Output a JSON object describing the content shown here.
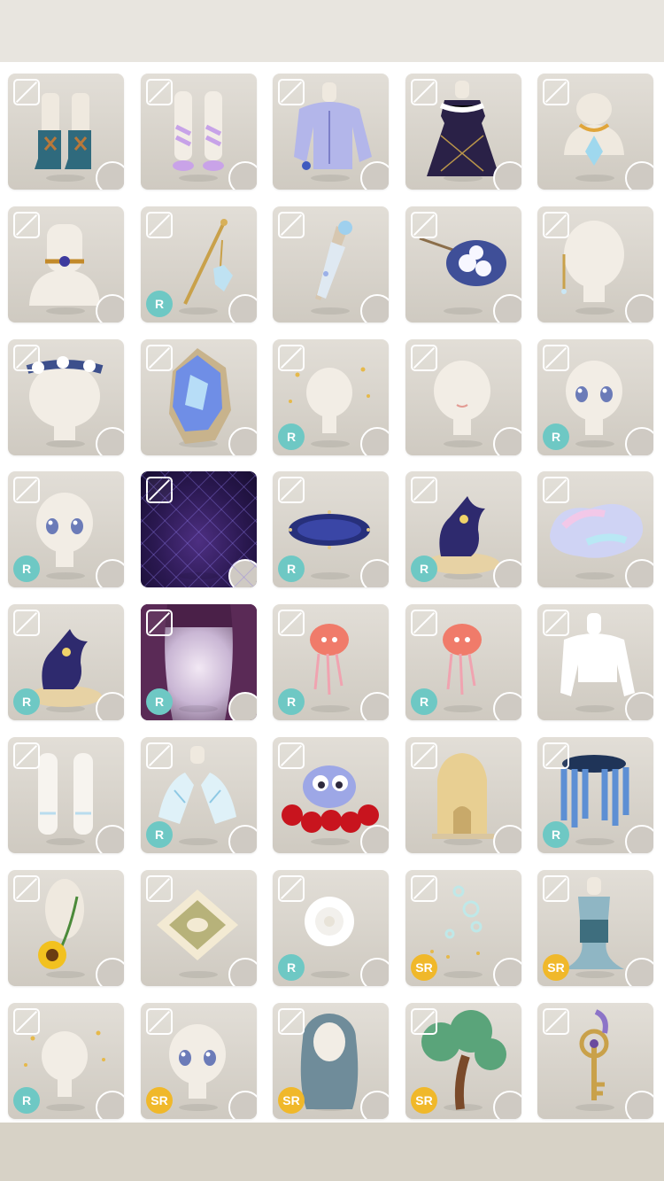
{
  "colors": {
    "top_bar": "#e8e5df",
    "bottom_bar": "#d7d2c6",
    "tile_bg": "#d9d5ce",
    "rarity_r": "#6ec8c4",
    "rarity_sr": "#f0b82a"
  },
  "items": [
    {
      "name": "teal-lace-boots-item",
      "icon": "boots-icon",
      "rarity": ""
    },
    {
      "name": "lilac-socks-item",
      "icon": "socks-icon",
      "rarity": ""
    },
    {
      "name": "lavender-blouse-item",
      "icon": "blouse-icon",
      "rarity": ""
    },
    {
      "name": "navy-quilted-dress-item",
      "icon": "dress-icon",
      "rarity": ""
    },
    {
      "name": "opal-pendant-item",
      "icon": "necklace-icon",
      "rarity": ""
    },
    {
      "name": "sapphire-choker-item",
      "icon": "choker-icon",
      "rarity": ""
    },
    {
      "name": "crystal-pendulum-wand-item",
      "icon": "wand-icon",
      "rarity": "R"
    },
    {
      "name": "star-bottle-item",
      "icon": "bottle-icon",
      "rarity": ""
    },
    {
      "name": "blue-rose-bouquet-item",
      "icon": "bouquet-icon",
      "rarity": ""
    },
    {
      "name": "gold-chain-earring-item",
      "icon": "earring-icon",
      "rarity": ""
    },
    {
      "name": "white-rose-crown-item",
      "icon": "flower-crown-icon",
      "rarity": ""
    },
    {
      "name": "blue-crystal-geode-item",
      "icon": "crystal-icon",
      "rarity": ""
    },
    {
      "name": "sparkle-halo-item",
      "icon": "sparkle-icon",
      "rarity": "R"
    },
    {
      "name": "smile-face-item",
      "icon": "face-icon",
      "rarity": ""
    },
    {
      "name": "blue-eyes-face-item",
      "icon": "eyes-icon",
      "rarity": "R"
    },
    {
      "name": "navy-eyes-face-item",
      "icon": "eyes-icon",
      "rarity": "R"
    },
    {
      "name": "purple-grid-background-item",
      "icon": "background-icon",
      "rarity": ""
    },
    {
      "name": "navy-rug-item",
      "icon": "rug-icon",
      "rarity": "R"
    },
    {
      "name": "purple-dragon-pet-item",
      "icon": "pet-icon",
      "rarity": "R"
    },
    {
      "name": "iridescent-stone-item",
      "icon": "stone-icon",
      "rarity": ""
    },
    {
      "name": "galaxy-dragon-pet-item",
      "icon": "pet-icon",
      "rarity": "R"
    },
    {
      "name": "purple-stage-curtain-item",
      "icon": "curtain-icon",
      "rarity": "R"
    },
    {
      "name": "pink-jellyfish-item",
      "icon": "jellyfish-icon",
      "rarity": "R"
    },
    {
      "name": "white-jellyfish-item",
      "icon": "jellyfish-icon",
      "rarity": "R"
    },
    {
      "name": "white-cropped-sweater-item",
      "icon": "sweater-icon",
      "rarity": ""
    },
    {
      "name": "white-stockings-item",
      "icon": "stockings-icon",
      "rarity": ""
    },
    {
      "name": "lace-gloves-item",
      "icon": "gloves-icon",
      "rarity": "R"
    },
    {
      "name": "bird-rose-nest-item",
      "icon": "bird-icon",
      "rarity": ""
    },
    {
      "name": "sand-castle-item",
      "icon": "castle-icon",
      "rarity": ""
    },
    {
      "name": "wisteria-hat-item",
      "icon": "hat-icon",
      "rarity": "R"
    },
    {
      "name": "sunflower-sash-item",
      "icon": "sunflower-icon",
      "rarity": ""
    },
    {
      "name": "leaf-stamp-item",
      "icon": "stamp-icon",
      "rarity": ""
    },
    {
      "name": "white-peony-item",
      "icon": "flower-icon",
      "rarity": "R"
    },
    {
      "name": "bubbles-effect-item",
      "icon": "bubbles-icon",
      "rarity": "SR"
    },
    {
      "name": "mermaid-tail-dress-item",
      "icon": "mermaid-icon",
      "rarity": "SR"
    },
    {
      "name": "golden-sparkle-face-item",
      "icon": "sparkle-icon",
      "rarity": "R"
    },
    {
      "name": "teal-lash-face-item",
      "icon": "eyes-icon",
      "rarity": "SR"
    },
    {
      "name": "long-teal-hair-item",
      "icon": "hair-icon",
      "rarity": "SR"
    },
    {
      "name": "bonsai-tree-item",
      "icon": "tree-icon",
      "rarity": "SR"
    },
    {
      "name": "golden-key-wand-item",
      "icon": "key-icon",
      "rarity": ""
    }
  ]
}
